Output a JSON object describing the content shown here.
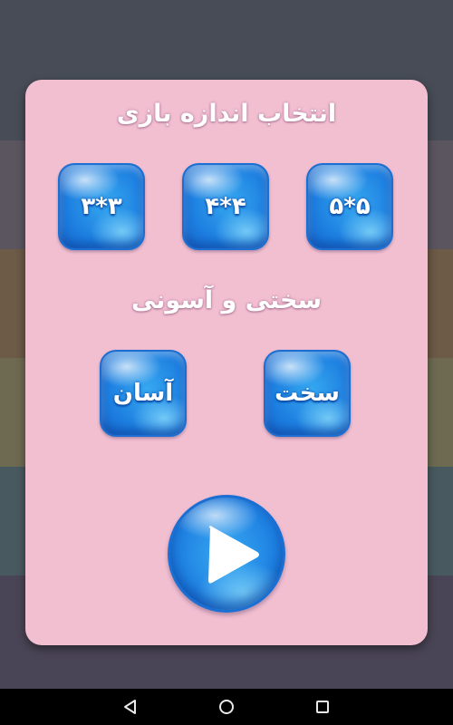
{
  "background": {
    "stripe_colors": [
      "#474c57",
      "#5b5560",
      "#6d5a47",
      "#6e6a52",
      "#485a60",
      "#4a4556"
    ]
  },
  "dialog": {
    "size_title": "انتخاب اندازه بازی",
    "size_options": [
      {
        "label": "۵*۵"
      },
      {
        "label": "۴*۴"
      },
      {
        "label": "۳*۳"
      }
    ],
    "difficulty_title": "سختی و آسونی",
    "difficulty_options": [
      {
        "label": "سخت"
      },
      {
        "label": "آسان"
      }
    ],
    "play_icon": "play-icon",
    "accent_color": "#1d7fe0",
    "panel_color": "#f2bfd1"
  },
  "nav_bar": {
    "buttons": [
      "back-icon",
      "home-icon",
      "recent-apps-icon"
    ]
  }
}
